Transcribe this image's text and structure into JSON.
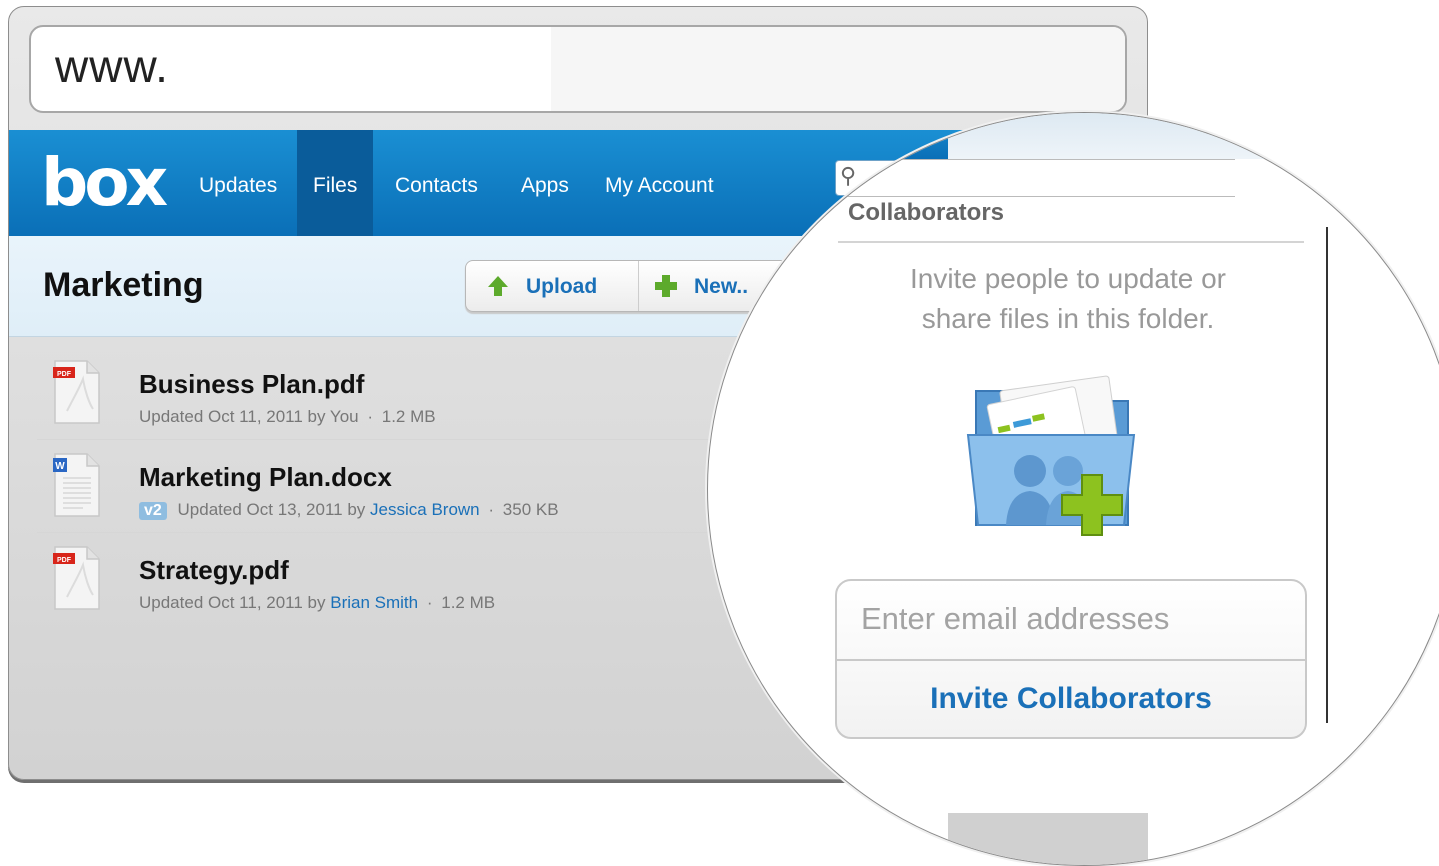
{
  "browser": {
    "url_text": "www."
  },
  "nav": {
    "logo": "box",
    "items": [
      {
        "label": "Updates"
      },
      {
        "label": "Files",
        "active": true
      },
      {
        "label": "Contacts"
      },
      {
        "label": "Apps"
      },
      {
        "label": "My Account"
      }
    ]
  },
  "folder": {
    "title": "Marketing",
    "upload_label": "Upload",
    "new_label": "New.."
  },
  "files": [
    {
      "name": "Business Plan.pdf",
      "type": "pdf",
      "icon_label": "PDF",
      "updated": "Updated Oct 11, 2011 by",
      "by": "You",
      "by_is_link": false,
      "sep": "·",
      "size": "1.2 MB"
    },
    {
      "name": "Marketing Plan.docx",
      "type": "docx",
      "icon_label": "W",
      "version": "v2",
      "updated": "Updated Oct 13, 2011 by",
      "by": "Jessica Brown",
      "by_is_link": true,
      "sep": "·",
      "size": "350 KB"
    },
    {
      "name": "Strategy.pdf",
      "type": "pdf",
      "icon_label": "PDF",
      "updated": "Updated Oct 11, 2011 by",
      "by": "Brian Smith",
      "by_is_link": true,
      "sep": "·",
      "size": "1.2 MB"
    }
  ],
  "collaborators": {
    "title": "Collaborators",
    "description_line1": "Invite people to update or",
    "description_line2": "share files in this folder.",
    "email_placeholder": "Enter email addresses",
    "invite_button": "Invite Collaborators"
  },
  "icons": {
    "upload": "arrow-up-icon",
    "new": "plus-icon",
    "search": "search-icon",
    "folder": "shared-folder-add-icon"
  },
  "colors": {
    "nav_blue": "#0a6fb7",
    "link_blue": "#1a70b8",
    "green": "#5daa2c",
    "plus_green": "#8dc21f"
  }
}
